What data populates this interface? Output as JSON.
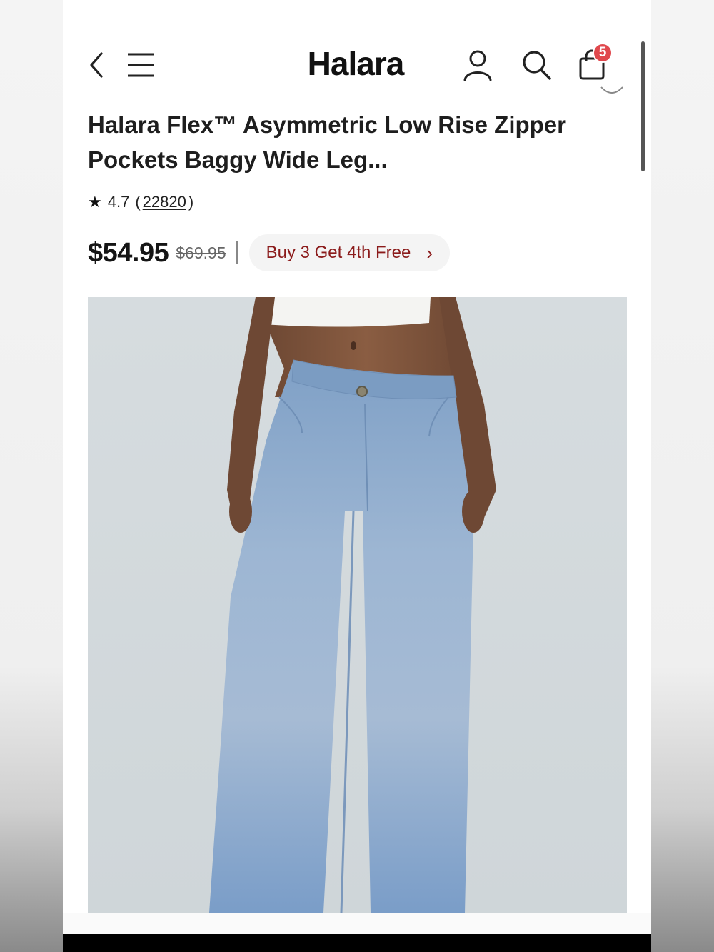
{
  "header": {
    "brand": "Halara",
    "cart_count": "5",
    "icons": {
      "back": "chevron-left-icon",
      "menu": "hamburger-menu-icon",
      "account": "user-icon",
      "search": "search-icon",
      "cart": "shopping-bag-icon"
    }
  },
  "product": {
    "title": "Halara Flex™ Asymmetric Low Rise Zipper Pockets Baggy Wide Leg...",
    "rating": "4.7",
    "review_count": "22820",
    "price": "$54.95",
    "original_price": "$69.95",
    "promo_label": "Buy 3 Get 4th Free",
    "image": "product-photo-wide-leg-jeans"
  },
  "colors": {
    "badge": "#e0484d",
    "promo_text": "#8b1b1b",
    "denim": "#8fb0d3"
  }
}
